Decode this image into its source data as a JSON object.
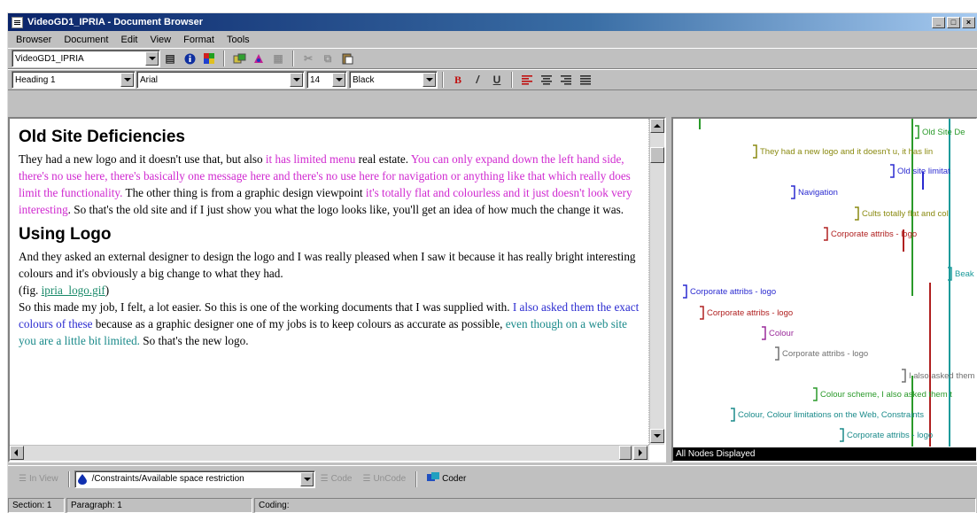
{
  "window": {
    "title": "VideoGD1_IPRIA - Document Browser"
  },
  "menu": {
    "items": [
      {
        "label": "Browser",
        "underline": "B",
        "rest": "rowser"
      },
      {
        "label": "Document",
        "underline": "D",
        "rest": "ocument"
      },
      {
        "label": "Edit",
        "underline": "E",
        "rest": "dit"
      },
      {
        "label": "View",
        "underline": "V",
        "rest": "iew"
      },
      {
        "label": "Format",
        "underline": "",
        "pre": "F",
        "u2": "o",
        "rest": "rmat"
      },
      {
        "label": "Tools",
        "underline": "T",
        "rest": "ools"
      }
    ]
  },
  "toolbar1": {
    "document_select": "VideoGD1_IPRIA"
  },
  "toolbar2": {
    "style": "Heading 1",
    "font": "Arial",
    "size": "14",
    "color": "Black",
    "bold": "B",
    "italic": "/",
    "underline": "U"
  },
  "document": {
    "sections": [
      {
        "heading": "Old Site Deficiencies",
        "paragraphs": [
          [
            {
              "text": "They had a new logo and it doesn't use that, but also ",
              "color": ""
            },
            {
              "text": "it has limited menu",
              "color": "mag"
            },
            {
              "text": " real estate. ",
              "color": ""
            },
            {
              "text": "You can only expand down the left hand side, there's no use here, there's basically one message here and there's no use here for navigation or anything like that which really does limit the functionality.",
              "color": "mag"
            },
            {
              "text": "  The other thing is from a graphic design viewpoint ",
              "color": ""
            },
            {
              "text": "it's totally flat and colourless and it just doesn't look very interesting",
              "color": "mag"
            },
            {
              "text": ".  So that's the old site and if I just show you what the logo looks like, you'll get an idea of how much the change it was.",
              "color": ""
            }
          ]
        ]
      },
      {
        "heading": "Using Logo",
        "paragraphs": [
          [
            {
              "text": "And they asked an external designer to design the logo and I was really pleased when I saw it because it has really bright interesting colours and it's obviously a big change to what they had.",
              "color": ""
            }
          ],
          [
            {
              "text": "(fig. ",
              "color": ""
            },
            {
              "text": "ipria_logo.gif",
              "color": "link"
            },
            {
              "text": ")",
              "color": ""
            }
          ],
          [
            {
              "text": "So this made my job, I felt, a lot easier.  So this is one of the working documents that I was supplied with. ",
              "color": ""
            },
            {
              "text": "I also asked them the exact colours of these",
              "color": "blue"
            },
            {
              "text": " because as a graphic designer one of my jobs is to keep colours as accurate as possible, ",
              "color": ""
            },
            {
              "text": "even though on a web site you are a little bit limited.",
              "color": "teal"
            },
            {
              "text": "  So that's the new logo.",
              "color": ""
            }
          ]
        ]
      }
    ]
  },
  "nodes": {
    "status": "All Nodes Displayed",
    "labels": [
      {
        "text": "Old Site De",
        "color": "#2a9a2a"
      },
      {
        "text": "They had a new logo and it doesn't u, it has lin",
        "color": "#8a8a10"
      },
      {
        "text": "Old site limitat",
        "color": "#2a2ad0"
      },
      {
        "text": "Navigation",
        "color": "#2a2ad0"
      },
      {
        "text": "Cults totally flat and col",
        "color": "#8a8a10"
      },
      {
        "text": "Corporate attribs - logo",
        "color": "#b02020"
      },
      {
        "text": "Beak",
        "color": "#1a9a9a"
      },
      {
        "text": "Corporate attribs - logo",
        "color": "#2a2ad0"
      },
      {
        "text": "Corporate attribs - logo",
        "color": "#b02020"
      },
      {
        "text": "Colour",
        "color": "#9a2a9a"
      },
      {
        "text": "Corporate attribs - logo",
        "color": "#707070"
      },
      {
        "text": "I also asked them t",
        "color": "#707070"
      },
      {
        "text": "Colour scheme, I also asked them t",
        "color": "#2a9a2a"
      },
      {
        "text": "Colour, Colour limitations on the Web, Constraints",
        "color": "#1a8a8a"
      },
      {
        "text": "Corporate attribs - logo",
        "color": "#1a8a8a"
      }
    ]
  },
  "bottombar": {
    "in_view": "In View",
    "node_path": "/Constraints/Available space restriction",
    "code": "Code",
    "uncode": "UnCode",
    "coder": "Coder"
  },
  "status": {
    "section": "Section: 1",
    "paragraph": "Paragraph: 1",
    "coding": "Coding:"
  }
}
